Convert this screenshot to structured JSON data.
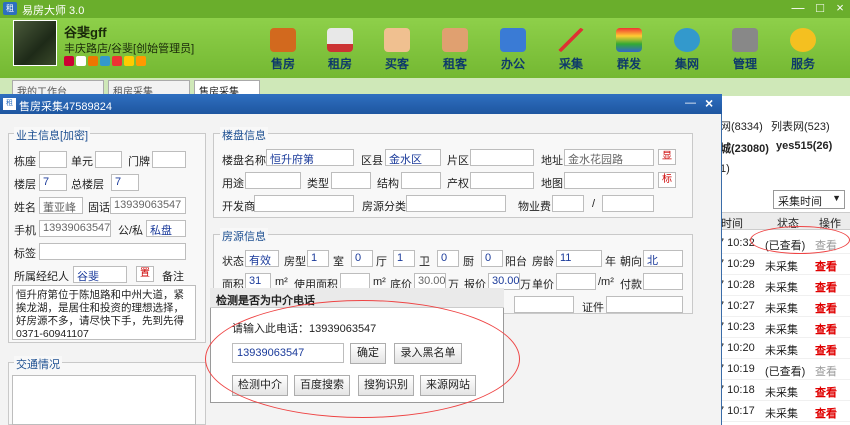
{
  "app": {
    "title": "易房大师 3.0",
    "logo": "租"
  },
  "user": {
    "name": "谷斐gff",
    "store": "丰庆路店/谷斐[创始管理员]"
  },
  "nav": [
    {
      "label": "售房"
    },
    {
      "label": "租房"
    },
    {
      "label": "买客"
    },
    {
      "label": "租客"
    },
    {
      "label": "办公"
    },
    {
      "label": "采集"
    },
    {
      "label": "群发"
    },
    {
      "label": "集网"
    },
    {
      "label": "管理"
    },
    {
      "label": "服务"
    }
  ],
  "tabs": [
    {
      "label": "我的工作台"
    },
    {
      "label": "租房采集"
    },
    {
      "label": "售房采集"
    }
  ],
  "window": {
    "title": "售房采集47589824"
  },
  "owner": {
    "section": "业主信息[加密]",
    "building_label": "栋座",
    "unit_label": "单元",
    "door_label": "门牌",
    "floor_label": "楼层",
    "floor_value": "7",
    "total_floor_label": "总楼层",
    "total_floor_value": "7",
    "name_label": "姓名",
    "name_value": "董亚峰",
    "tel_label": "固话",
    "tel_value": "13939063547",
    "mobile_label": "手机",
    "mobile_value": "13939063547",
    "type_label": "公/私",
    "type_value": "私盘",
    "tag_label": "标签",
    "agent_label": "所属经纪人",
    "agent_value": "谷斐",
    "agent_btn": "置",
    "remark_label": "备注",
    "remark": "恒升府第位于陈旭路和中州大道，紧挨龙湖，是居住和投资的理想选择，好房源不多，请尽快下手，先到先得0371-60941107",
    "traffic_label": "交通情况"
  },
  "property": {
    "section": "楼盘信息",
    "name_label": "楼盘名称",
    "name_value": "恒升府第",
    "district_label": "区县",
    "district_value": "金水区",
    "area_label": "片区",
    "address_label": "地址",
    "address_value": "金水花园路",
    "show_btn": "显",
    "usage_label": "用途",
    "type_label": "类型",
    "structure_label": "结构",
    "right_label": "产权",
    "map_label": "地图",
    "mark_btn": "标",
    "developer_label": "开发商",
    "source_label": "房源分类",
    "fee_label": "物业费",
    "slash": "/"
  },
  "listing": {
    "section": "房源信息",
    "status_label": "状态",
    "status_value": "有效",
    "layout_label": "房型",
    "rooms": "1",
    "room_unit": "室",
    "halls": "0",
    "hall_unit": "厅",
    "baths": "1",
    "bath_unit": "卫",
    "kitchens": "0",
    "kitchen_unit": "厨",
    "balconies": "0",
    "balcony_unit": "阳台",
    "age_label": "房龄",
    "age_value": "11",
    "age_unit": "年",
    "orient_label": "朝向",
    "orient_value": "北",
    "area_label": "面积",
    "area_value": "31",
    "area_unit": "m²",
    "use_area_label": "使用面积",
    "use_unit": "m²",
    "base_label": "底价",
    "base_value": "30.00",
    "wan1": "万",
    "price_label": "报价",
    "price_value": "30.00",
    "wan2": "万",
    "unit_price_label": "单价",
    "unit_price_unit": "/m²",
    "pay_label": "付款",
    "cert_label": "证件"
  },
  "dialog": {
    "title": "检测是否为中介电话",
    "prompt": "请输入此电话：13939063547",
    "phone": "13939063547",
    "confirm": "确定",
    "blacklist": "录入黑名单",
    "check": "检测中介",
    "baidu": "百度搜索",
    "sogou": "搜狗识别",
    "source": "来源网站"
  },
  "right": {
    "line1_a": "网(8334)",
    "line1_b": "列表网(523)",
    "line2_a": "城(23080)",
    "line2_b": "yes515(26)",
    "line3": "1)",
    "sort": "采集时间",
    "col_time": "时间",
    "col_status": "状态",
    "col_op": "操作",
    "rows": [
      {
        "time": "7 10:32",
        "status": "(已查看)",
        "op": "查看",
        "viewed": true
      },
      {
        "time": "7 10:29",
        "status": "未采集",
        "op": "查看",
        "viewed": false
      },
      {
        "time": "7 10:28",
        "status": "未采集",
        "op": "查看",
        "viewed": false
      },
      {
        "time": "7 10:27",
        "status": "未采集",
        "op": "查看",
        "viewed": false
      },
      {
        "time": "7 10:23",
        "status": "未采集",
        "op": "查看",
        "viewed": false
      },
      {
        "time": "7 10:20",
        "status": "未采集",
        "op": "查看",
        "viewed": false
      },
      {
        "time": "7 10:19",
        "status": "(已查看)",
        "op": "查看",
        "viewed": true
      },
      {
        "time": "7 10:18",
        "status": "未采集",
        "op": "查看",
        "viewed": false
      },
      {
        "time": "7 10:17",
        "status": "未采集",
        "op": "查看",
        "viewed": false
      }
    ]
  },
  "colors": {
    "brand_green": "#7bc03a",
    "window_blue": "#1e56a0",
    "annotation_red": "#e44444",
    "link_red": "#e00000"
  }
}
